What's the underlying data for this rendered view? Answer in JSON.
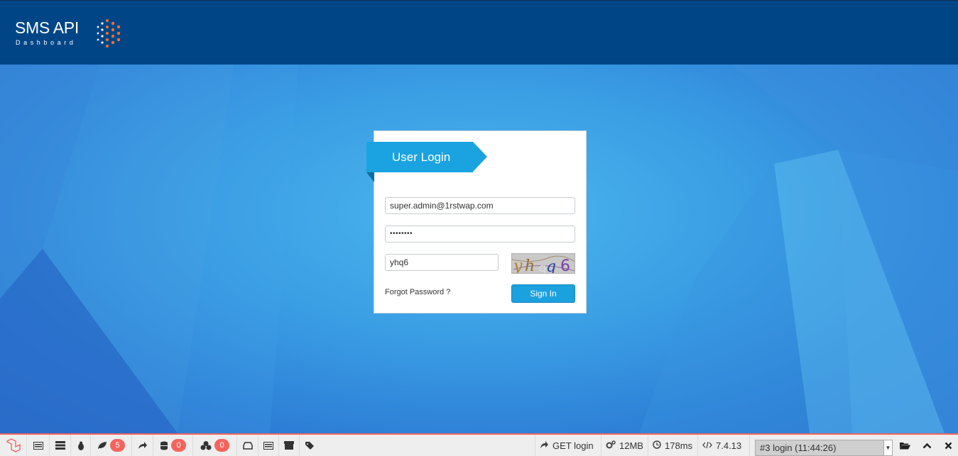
{
  "header": {
    "title": "SMS API",
    "subtitle": "Dashboard"
  },
  "login": {
    "heading": "User Login",
    "email_value": "super.admin@1rstwap.com",
    "password_value": "••••••••",
    "captcha_value": "yhq6",
    "captcha_image_text": "yhq6",
    "forgot_label": "Forgot Password ?",
    "signin_label": "Sign In"
  },
  "debugbar": {
    "badges": {
      "messages": "5",
      "queries": "0",
      "models": "0"
    },
    "request": "GET login",
    "memory": "12MB",
    "time": "178ms",
    "php_version": "7.4.13",
    "request_select": "#3 login (11:44:26)"
  },
  "colors": {
    "header": "#004687",
    "accent": "#1aa3e0",
    "debug_accent": "#f4645f"
  }
}
